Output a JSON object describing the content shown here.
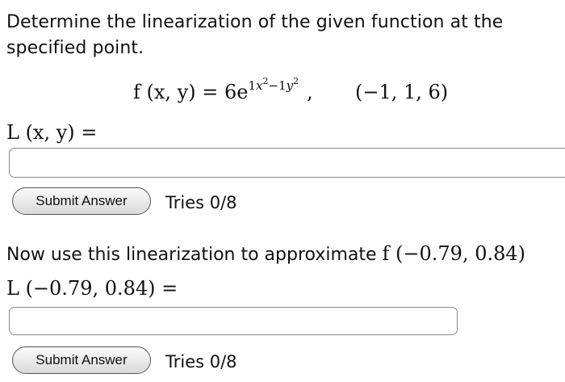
{
  "question": {
    "prompt": "Determine the linearization of the given function at the specified point."
  },
  "equation": {
    "lhs": "f (x, y) = 6e",
    "exponent": {
      "c1": "1",
      "v1": "x",
      "p1": "2",
      "minus": "−",
      "c2": "1",
      "v2": "y",
      "p2": "2"
    },
    "comma": ",",
    "point": "(−1, 1, 6)"
  },
  "part1": {
    "label": "L (x, y) =",
    "input_value": "",
    "submit_label": "Submit Answer",
    "tries": "Tries 0/8"
  },
  "part2": {
    "text": "Now use this linearization to approximate",
    "expression": "f (−0.79, 0.84)",
    "label": "L (−0.79, 0.84) =",
    "input_value": "",
    "submit_label": "Submit Answer",
    "tries": "Tries 0/8"
  }
}
